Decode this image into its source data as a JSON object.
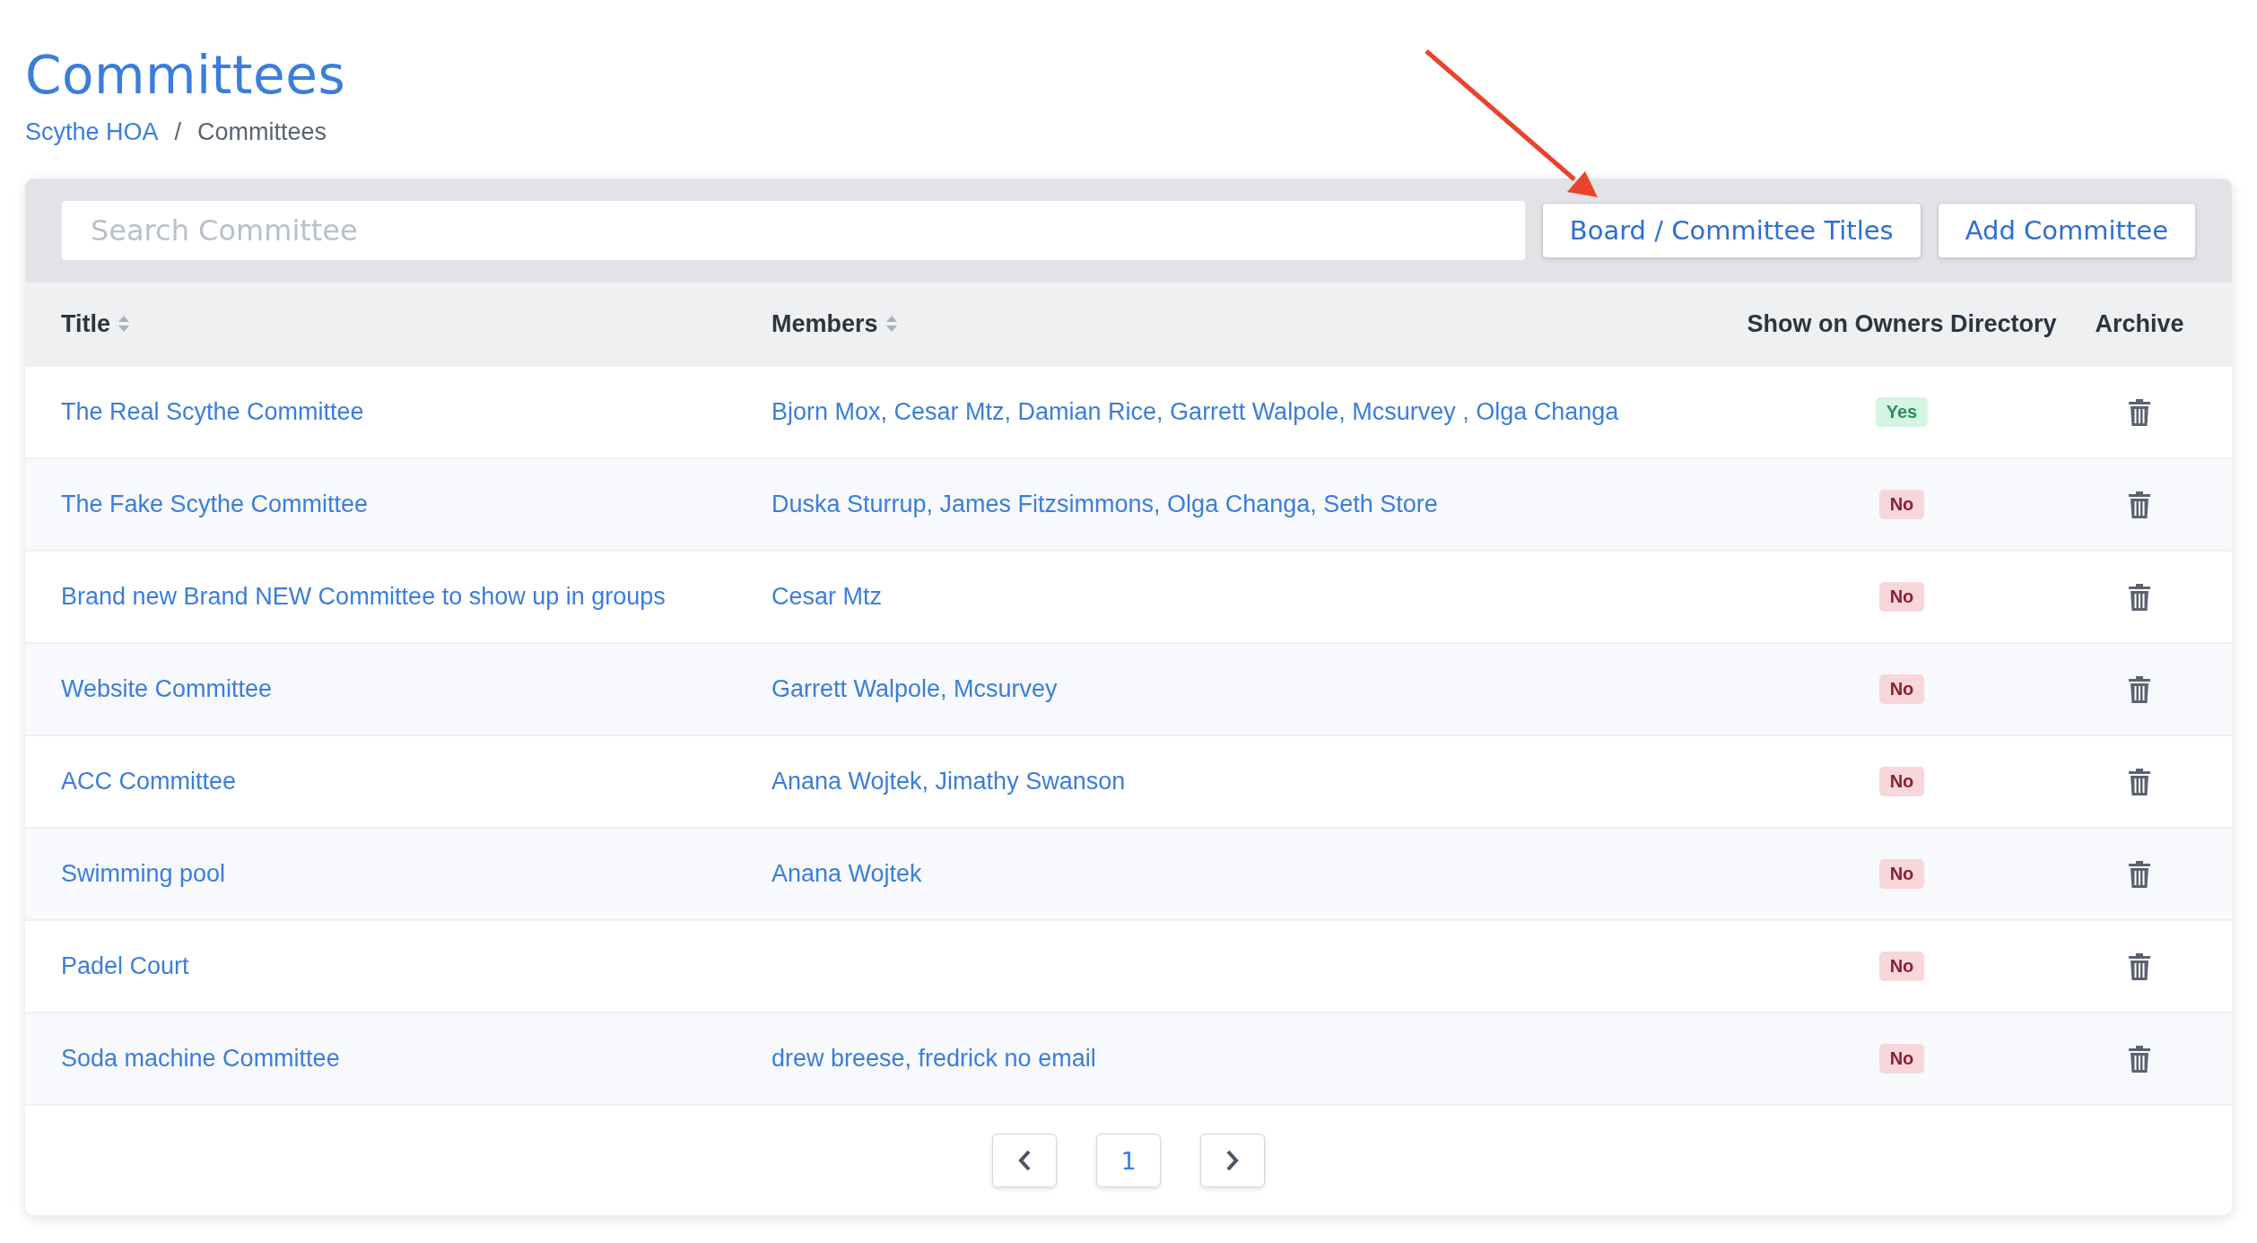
{
  "page": {
    "title": "Committees"
  },
  "breadcrumb": [
    {
      "label": "Scythe HOA",
      "link": true
    },
    {
      "label": "Committees",
      "link": false,
      "separator": "/"
    }
  ],
  "search": {
    "placeholder": "Search Committee"
  },
  "buttons": [
    "Board / Committee Titles",
    "Add Committee"
  ],
  "table": {
    "columns": [
      {
        "label": "Title",
        "sortable": true
      },
      {
        "label": "Members",
        "sortable": true
      },
      {
        "label": "Show on Owners Directory",
        "sortable": false
      },
      {
        "label": "Archive",
        "sortable": false
      }
    ],
    "rows": [
      {
        "title": "The Real Scythe Committee",
        "members": "Bjorn Mox, Cesar Mtz, Damian Rice, Garrett Walpole, Mcsurvey , Olga Changa",
        "listed": true,
        "badge": "Yes"
      },
      {
        "title": "The Fake Scythe Committee",
        "members": "Duska Sturrup, James Fitzsimmons, Olga Changa, Seth Store",
        "listed": false,
        "badge": "No"
      },
      {
        "title": "Brand new Brand NEW Committee to show up in groups",
        "members": "Cesar Mtz",
        "listed": false,
        "badge": "No"
      },
      {
        "title": "Website Committee",
        "members": "Garrett Walpole, Mcsurvey",
        "listed": false,
        "badge": "No"
      },
      {
        "title": "ACC Committee",
        "members": "Anana Wojtek, Jimathy Swanson",
        "listed": false,
        "badge": "No"
      },
      {
        "title": "Swimming pool",
        "members": "Anana Wojtek",
        "listed": false,
        "badge": "No"
      },
      {
        "title": "Padel Court",
        "listed": false,
        "badge": "No"
      },
      {
        "title": "Soda machine Committee",
        "members": "drew breese, fredrick no email",
        "listed": false,
        "badge": "No"
      }
    ]
  },
  "pagination": {
    "pages": [
      {
        "label": "1",
        "selected": true
      }
    ]
  }
}
